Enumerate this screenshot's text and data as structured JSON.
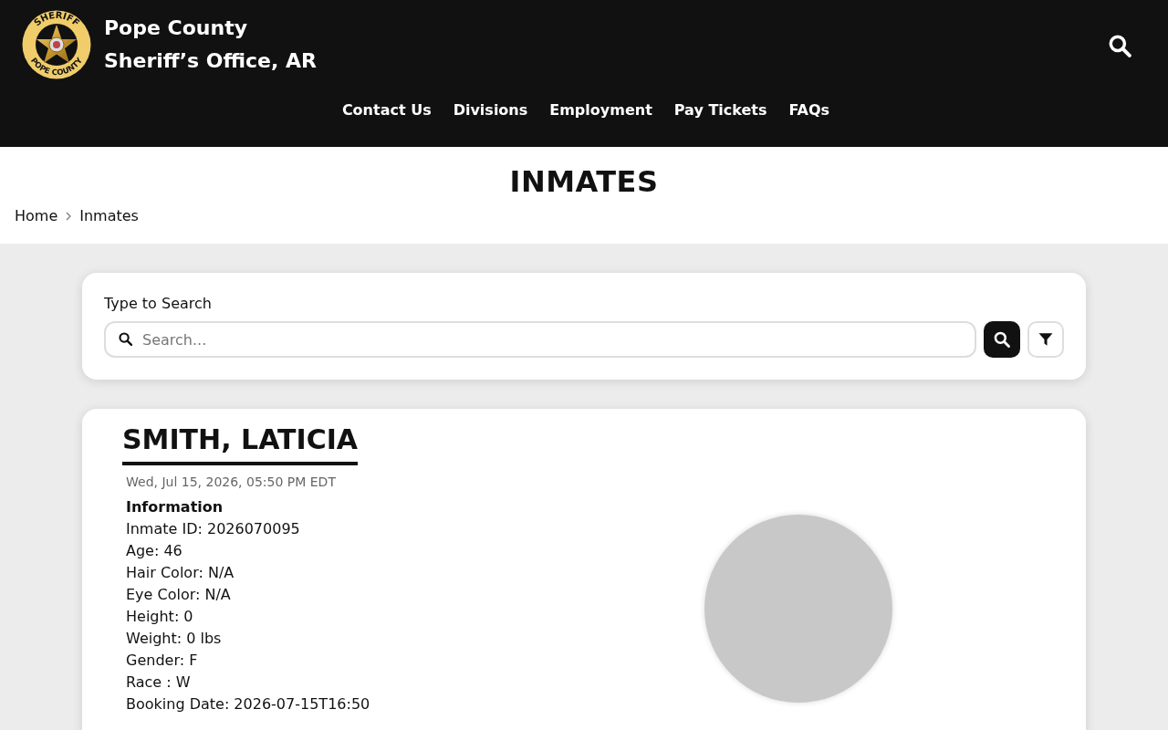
{
  "header": {
    "logo": {
      "top_text": "SHERIFF",
      "bottom_text": "POPE COUNTY"
    },
    "title_lines": [
      "Pope County",
      "Sheriff’s Office, AR"
    ]
  },
  "nav": [
    "Contact Us",
    "Divisions",
    "Employment",
    "Pay Tickets",
    "FAQs"
  ],
  "page_title": "INMATES",
  "breadcrumb": [
    "Home",
    "Inmates"
  ],
  "search": {
    "label": "Type to Search",
    "placeholder": "Search..."
  },
  "inmate": {
    "name": "SMITH, LATICIA",
    "timestamp": "Wed, Jul 15, 2026, 05:50 PM EDT",
    "section": "Information",
    "details": [
      "Inmate ID: 2026070095",
      "Age: 46",
      "Hair Color: N/A",
      "Eye Color: N/A",
      "Height: 0",
      "Weight: 0 lbs",
      "Gender: F",
      "Race : W",
      "Booking Date: 2026-07-15T16:50"
    ]
  }
}
